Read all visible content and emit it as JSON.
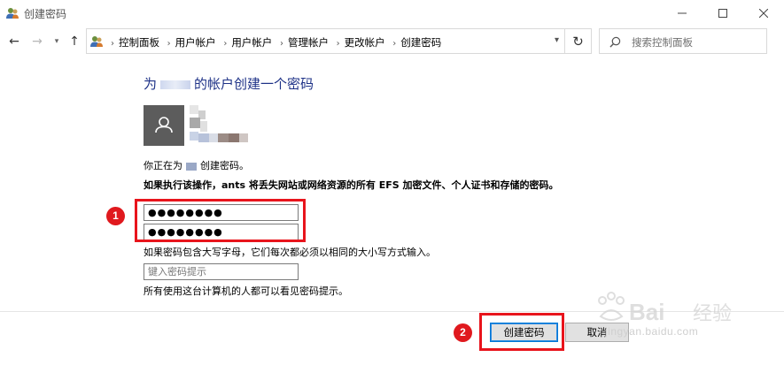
{
  "window": {
    "title": "创建密码",
    "icon": "users-icon"
  },
  "nav": {
    "back": "←",
    "forward": "→",
    "recent": "▾",
    "up": "↑",
    "breadcrumbs": [
      "控制面板",
      "用户帐户",
      "用户帐户",
      "管理帐户",
      "更改帐户",
      "创建密码"
    ],
    "refresh": "↻",
    "search_placeholder": "搜索控制面板"
  },
  "content": {
    "heading_prefix": "为",
    "heading_suffix": "的帐户创建一个密码",
    "info_prefix": "你正在为",
    "info_suffix": "创建密码。",
    "warning": "如果执行该操作，ants 将丢失网站或网络资源的所有 EFS 加密文件、个人证书和存储的密码。",
    "password_value": "●●●●●●●●",
    "confirm_value": "●●●●●●●●",
    "case_note": "如果密码包含大写字母，它们每次都必须以相同的大小写方式输入。",
    "hint_placeholder": "键入密码提示",
    "hint_note": "所有使用这台计算机的人都可以看见密码提示。"
  },
  "buttons": {
    "create": "创建密码",
    "cancel": "取消"
  },
  "annotations": {
    "marker1": "1",
    "marker2": "2",
    "highlight_color": "#e8141c"
  },
  "watermark": {
    "logo": "Bai 经验",
    "url": "jingyan.baidu.com"
  },
  "colors": {
    "heading": "#1e3287",
    "accent": "#0078d7"
  }
}
